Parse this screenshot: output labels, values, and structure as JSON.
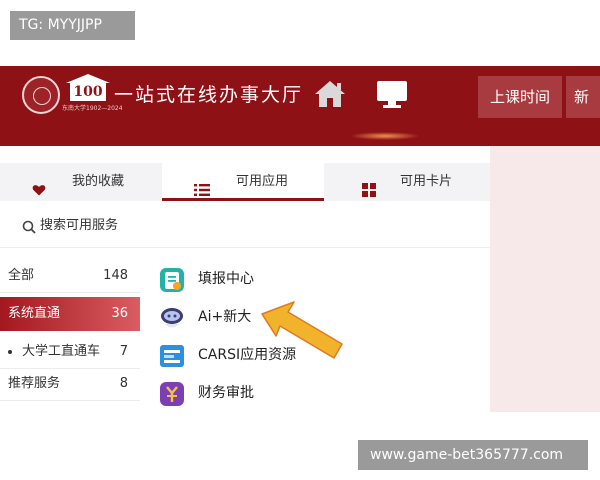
{
  "watermark_top": "TG: MYYJJPP",
  "watermark_bottom": "www.game-bet365777.com",
  "header": {
    "title": "一站式在线办事大厅",
    "logo_number": "100",
    "logo_motto": "东南大学1902—2024",
    "nav_buttons": [
      "上课时间",
      "新"
    ],
    "icons": [
      "home-icon",
      "monitor-icon"
    ]
  },
  "tabs": [
    {
      "label": "我的收藏",
      "icon": "heart-icon"
    },
    {
      "label": "可用应用",
      "icon": "list-icon"
    },
    {
      "label": "可用卡片",
      "icon": "grid-icon"
    }
  ],
  "search": {
    "placeholder": "搜索可用服务"
  },
  "categories": [
    {
      "name": "全部",
      "count": "148"
    },
    {
      "name": "系统直通",
      "count": "36"
    },
    {
      "name": "大学工直通车",
      "count": "7"
    },
    {
      "name": "推荐服务",
      "count": "8"
    }
  ],
  "apps": [
    {
      "name": "填报中心",
      "icon": "form-icon"
    },
    {
      "name": "Ai+新大",
      "icon": "robot-icon"
    },
    {
      "name": "CARSI应用资源",
      "icon": "resource-icon"
    },
    {
      "name": "财务审批",
      "icon": "finance-icon"
    }
  ],
  "colors": {
    "brand": "#8e1116",
    "active_category": "#a3181e",
    "arrow": "#f1b22c"
  }
}
